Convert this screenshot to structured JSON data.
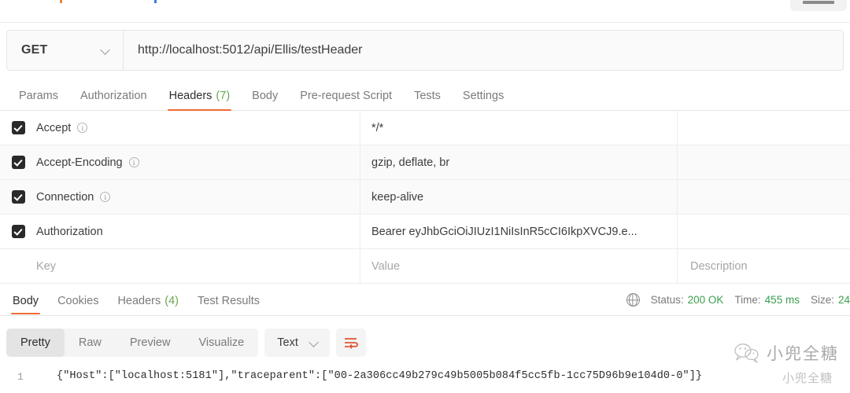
{
  "request": {
    "method": "GET",
    "url": "http://localhost:5012/api/Ellis/testHeader",
    "tabs": [
      {
        "label": "Params",
        "count": "",
        "active": false
      },
      {
        "label": "Authorization",
        "count": "",
        "active": false
      },
      {
        "label": "Headers",
        "count": "(7)",
        "active": true
      },
      {
        "label": "Body",
        "count": "",
        "active": false
      },
      {
        "label": "Pre-request Script",
        "count": "",
        "active": false
      },
      {
        "label": "Tests",
        "count": "",
        "active": false
      },
      {
        "label": "Settings",
        "count": "",
        "active": false
      }
    ]
  },
  "headers_table": {
    "placeholders": {
      "key": "Key",
      "value": "Value",
      "description": "Description"
    },
    "rows": [
      {
        "checked": true,
        "key": "Accept",
        "info": true,
        "value": "*/*",
        "description": ""
      },
      {
        "checked": true,
        "key": "Accept-Encoding",
        "info": true,
        "value": "gzip, deflate, br",
        "description": ""
      },
      {
        "checked": true,
        "key": "Connection",
        "info": true,
        "value": "keep-alive",
        "description": ""
      },
      {
        "checked": true,
        "key": "Authorization",
        "info": false,
        "value": "Bearer eyJhbGciOiJIUzI1NiIsInR5cCI6IkpXVCJ9.e...",
        "description": ""
      }
    ]
  },
  "response": {
    "tabs": [
      {
        "label": "Body",
        "count": "",
        "active": true
      },
      {
        "label": "Cookies",
        "count": "",
        "active": false
      },
      {
        "label": "Headers",
        "count": "(4)",
        "active": false
      },
      {
        "label": "Test Results",
        "count": "",
        "active": false
      }
    ],
    "status_label": "Status:",
    "status_value": "200 OK",
    "time_label": "Time:",
    "time_value": "455 ms",
    "size_label": "Size:",
    "size_value": "24",
    "format_tabs": [
      {
        "label": "Pretty",
        "active": true
      },
      {
        "label": "Raw",
        "active": false
      },
      {
        "label": "Preview",
        "active": false
      },
      {
        "label": "Visualize",
        "active": false
      }
    ],
    "type_selector": "Text",
    "line_number": "1",
    "body_line": "{\"Host\":[\"localhost:5181\"],\"traceparent\":[\"00-2a306cc49b279c49b5005b084f5cc5fb-1cc75D96b9e104d0-0\"]}"
  },
  "watermark": {
    "text": "小兜全糖",
    "secondary": "小兜全糖"
  },
  "colors": {
    "accent": "#ef6c35",
    "success": "#6aa84f",
    "status": "#3a9e4f",
    "text": "#3d3d3d",
    "muted": "#7b7b7b"
  }
}
